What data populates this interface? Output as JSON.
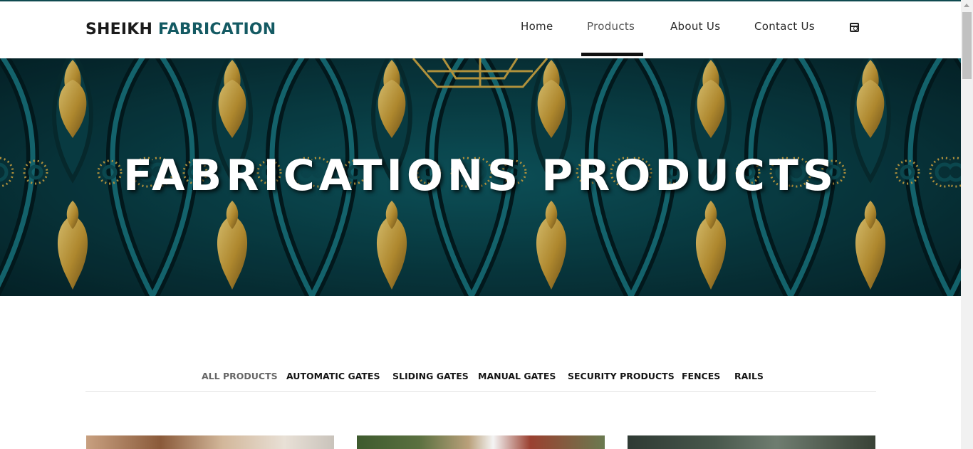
{
  "brand": {
    "part1": "SHEIKH",
    "part2": "FABRICATION"
  },
  "nav": {
    "items": [
      {
        "label": "Home"
      },
      {
        "label": "Products"
      },
      {
        "label": "About Us"
      },
      {
        "label": "Contact Us"
      }
    ],
    "active": "Products",
    "social_icon": "instagram-icon"
  },
  "hero": {
    "title": "FABRICATIONS PRODUCTS"
  },
  "filters": {
    "tabs": [
      {
        "label": "ALL PRODUCTS"
      },
      {
        "label": "AUTOMATIC GATES"
      },
      {
        "label": "SLIDING GATES"
      },
      {
        "label": "MANUAL GATES"
      },
      {
        "label": "SECURITY PRODUCTS"
      },
      {
        "label": "FENCES"
      },
      {
        "label": "RAILS"
      }
    ],
    "active": "ALL PRODUCTS"
  },
  "colors": {
    "brand_accent": "#145a63",
    "hero_teal": "#0b4a52",
    "hero_gold": "#c9a545",
    "text_dark": "#1b1b1b"
  }
}
